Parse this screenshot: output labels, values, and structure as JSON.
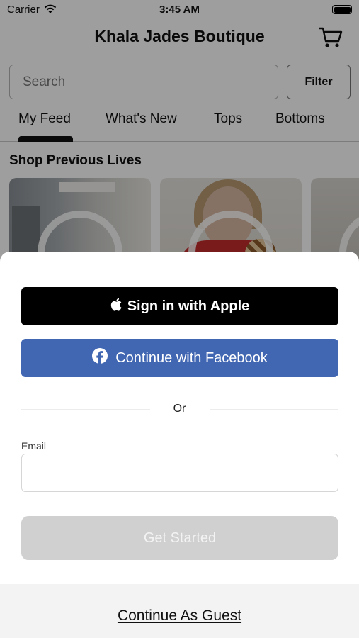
{
  "status_bar": {
    "carrier": "Carrier",
    "time": "3:45 AM"
  },
  "header": {
    "title": "Khala Jades Boutique",
    "cart_icon": "cart-icon"
  },
  "search": {
    "placeholder": "Search",
    "filter_label": "Filter"
  },
  "tabs": [
    {
      "label": "My Feed",
      "active": true
    },
    {
      "label": "What's New",
      "active": false
    },
    {
      "label": "Tops",
      "active": false
    },
    {
      "label": "Bottoms",
      "active": false
    }
  ],
  "feed": {
    "section_title": "Shop Previous Lives"
  },
  "login_sheet": {
    "apple_label": "Sign in with Apple",
    "facebook_label": "Continue with Facebook",
    "or_label": "Or",
    "email_label": "Email",
    "email_value": "",
    "get_started_label": "Get Started",
    "guest_label": "Continue As Guest",
    "colors": {
      "apple": "#000000",
      "facebook": "#4267b2",
      "disabled": "#d0d0d0"
    }
  }
}
